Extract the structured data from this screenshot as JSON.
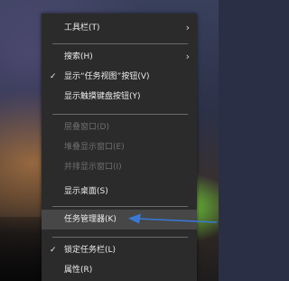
{
  "context_menu": {
    "items": [
      {
        "label": "工具栏(T)",
        "submenu": true
      },
      {
        "label": "搜索(H)",
        "submenu": true
      },
      {
        "label": "显示“任务视图”按钮(V)",
        "checked": true
      },
      {
        "label": "显示触摸键盘按钮(Y)"
      },
      {
        "label": "层叠窗口(D)",
        "disabled": true
      },
      {
        "label": "堆叠显示窗口(E)",
        "disabled": true
      },
      {
        "label": "并排显示窗口(I)",
        "disabled": true
      },
      {
        "label": "显示桌面(S)"
      },
      {
        "label": "任务管理器(K)",
        "highlighted": true
      },
      {
        "label": "锁定任务栏(L)",
        "checked": true
      },
      {
        "label": "属性(R)"
      }
    ],
    "check_glyph": "✓",
    "chevron_glyph": "›"
  },
  "colors": {
    "menu_bg": "#2b2b2b",
    "highlight_bg": "#474747",
    "annotation_arrow": "#3a78d8"
  }
}
